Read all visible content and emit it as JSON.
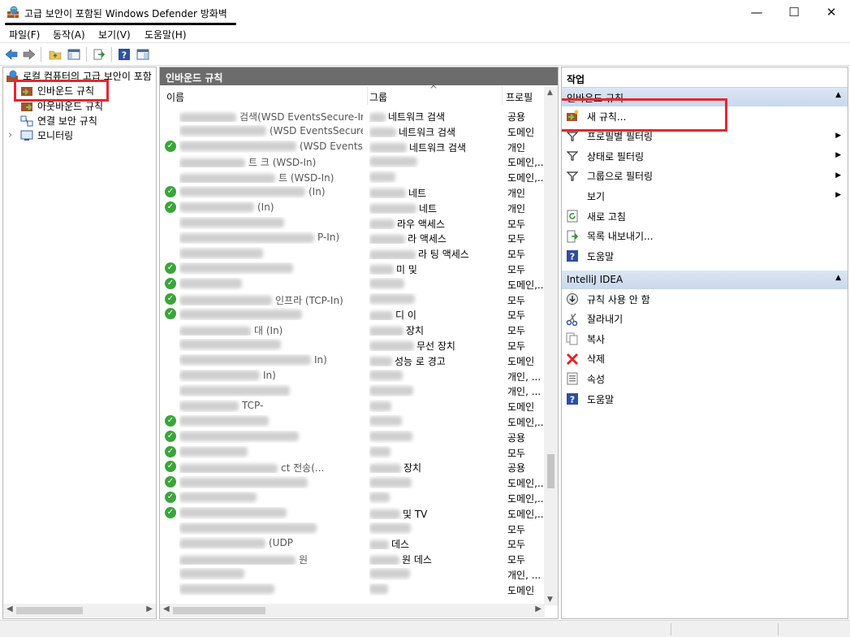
{
  "window": {
    "title": "고급 보안이 포함된 Windows Defender 방화벽",
    "minimize": "—",
    "maximize": "☐",
    "close": "✕"
  },
  "menu": [
    "파일(F)",
    "동작(A)",
    "보기(V)",
    "도움말(H)"
  ],
  "toolbar": {
    "icons": [
      "back-arrow-icon",
      "forward-arrow-icon",
      "folder-up-icon",
      "show-hide-tree-icon",
      "export-icon",
      "help-icon",
      "properties-pane-icon"
    ]
  },
  "tree": {
    "root": "로컬 컴퓨터의 고급 보안이 포함",
    "items": [
      "인바운드 규칙",
      "아웃바운드 규칙",
      "연결 보안 규칙",
      "모니터링"
    ],
    "expander": "›"
  },
  "list": {
    "header": "인바운드 규칙",
    "columns": [
      "이름",
      "그룹",
      "프로필"
    ],
    "sort_glyph": "^",
    "rows": [
      {
        "enabled": false,
        "name": "검색(WSD EventsSecure-In)",
        "group": "네트워크 검색",
        "profile": "공용"
      },
      {
        "enabled": false,
        "name": "(WSD EventsSecure-In)",
        "group": "네트워크 검색",
        "profile": "도메인"
      },
      {
        "enabled": true,
        "name": "(WSD EventsSecur",
        "group": "네트워크 검색",
        "profile": "개인"
      },
      {
        "enabled": false,
        "name": "트 크 (WSD-In)",
        "group": "",
        "profile": "도메인,..."
      },
      {
        "enabled": false,
        "name": "트 (WSD-In)",
        "group": "",
        "profile": "도메인,..."
      },
      {
        "enabled": true,
        "name": "(In)",
        "group": "네트",
        "profile": "개인"
      },
      {
        "enabled": true,
        "name": "(In)",
        "group": "네트",
        "profile": "개인"
      },
      {
        "enabled": false,
        "name": "",
        "group": "라우 액세스",
        "profile": "모두"
      },
      {
        "enabled": false,
        "name": "P-In)",
        "group": "라 액세스",
        "profile": "모두"
      },
      {
        "enabled": false,
        "name": "",
        "group": "라 팅 액세스",
        "profile": "모두"
      },
      {
        "enabled": true,
        "name": "",
        "group": "미 및",
        "profile": "모두"
      },
      {
        "enabled": true,
        "name": "",
        "group": "",
        "profile": "도메인,..."
      },
      {
        "enabled": true,
        "name": "인프라 (TCP-In)",
        "group": "",
        "profile": "모두"
      },
      {
        "enabled": true,
        "name": "",
        "group": "디 이",
        "profile": "모두"
      },
      {
        "enabled": false,
        "name": "대 (In)",
        "group": "장치",
        "profile": "모두"
      },
      {
        "enabled": false,
        "name": "",
        "group": "무선 장치",
        "profile": "모두"
      },
      {
        "enabled": false,
        "name": "In)",
        "group": "성능 로 경고",
        "profile": "도메인"
      },
      {
        "enabled": false,
        "name": "In)",
        "group": "",
        "profile": "개인, ..."
      },
      {
        "enabled": false,
        "name": "",
        "group": "",
        "profile": "개인, ..."
      },
      {
        "enabled": false,
        "name": "TCP-",
        "group": "",
        "profile": "도메인"
      },
      {
        "enabled": true,
        "name": "",
        "group": "",
        "profile": "도메인,..."
      },
      {
        "enabled": true,
        "name": "",
        "group": "",
        "profile": "공용"
      },
      {
        "enabled": true,
        "name": "",
        "group": "",
        "profile": "모두"
      },
      {
        "enabled": true,
        "name": "ct 전송(...",
        "group": "장치",
        "profile": "공용"
      },
      {
        "enabled": true,
        "name": "",
        "group": "",
        "profile": "도메인,..."
      },
      {
        "enabled": true,
        "name": "",
        "group": "",
        "profile": "도메인,..."
      },
      {
        "enabled": true,
        "name": "",
        "group": "및 TV",
        "profile": "도메인,..."
      },
      {
        "enabled": false,
        "name": "",
        "group": "",
        "profile": "모두"
      },
      {
        "enabled": false,
        "name": "(UDP",
        "group": "데스",
        "profile": "모두"
      },
      {
        "enabled": false,
        "name": "원",
        "group": "원 데스",
        "profile": "모두"
      },
      {
        "enabled": false,
        "name": "",
        "group": "",
        "profile": "개인, ..."
      },
      {
        "enabled": false,
        "name": "",
        "group": "",
        "profile": "도메인"
      }
    ]
  },
  "actions": {
    "title": "작업",
    "section1": {
      "label": "인바운드 규칙",
      "items": [
        {
          "label": "새 규칙...",
          "icon": "new-rule-icon",
          "submenu": false
        },
        {
          "label": "프로필별 필터링",
          "icon": "filter-icon",
          "submenu": true
        },
        {
          "label": "상태로 필터링",
          "icon": "filter-icon",
          "submenu": true
        },
        {
          "label": "그룹으로 필터링",
          "icon": "filter-icon",
          "submenu": true
        },
        {
          "label": "보기",
          "icon": "",
          "submenu": true
        },
        {
          "label": "새로 고침",
          "icon": "refresh-icon",
          "submenu": false
        },
        {
          "label": "목록 내보내기...",
          "icon": "export-list-icon",
          "submenu": false
        },
        {
          "label": "도움말",
          "icon": "help-icon",
          "submenu": false
        }
      ]
    },
    "section2": {
      "label": "IntelliJ IDEA",
      "items": [
        {
          "label": "규칙 사용 안 함",
          "icon": "disable-rule-icon"
        },
        {
          "label": "잘라내기",
          "icon": "cut-icon"
        },
        {
          "label": "복사",
          "icon": "copy-icon"
        },
        {
          "label": "삭제",
          "icon": "delete-icon"
        },
        {
          "label": "속성",
          "icon": "properties-icon"
        },
        {
          "label": "도움말",
          "icon": "help-icon"
        }
      ]
    },
    "collapse_glyph": "▲",
    "submenu_glyph": "▶"
  },
  "colors": {
    "highlight_red": "#e52730",
    "pane_header": "#6c6c6c",
    "section_header": "#d3e0f1",
    "enabled_check": "#3aa53a"
  }
}
